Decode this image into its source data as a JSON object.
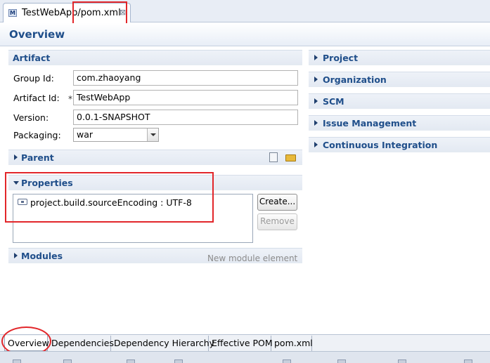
{
  "editor_tab": {
    "title": "TestWebApp/pom.xml",
    "icon_letter": "M",
    "close_glyph": "⊠"
  },
  "header": {
    "title": "Overview"
  },
  "artifact": {
    "title": "Artifact",
    "group_id_label": "Group Id:",
    "group_id_value": "com.zhaoyang",
    "artifact_id_label": "Artifact Id:",
    "artifact_id_required": "*",
    "artifact_id_value": "TestWebApp",
    "version_label": "Version:",
    "version_value": "0.0.1-SNAPSHOT",
    "packaging_label": "Packaging:",
    "packaging_value": "war"
  },
  "parent": {
    "title": "Parent"
  },
  "properties": {
    "title": "Properties",
    "items": [
      "project.build.sourceEncoding : UTF-8"
    ],
    "create_label": "Create...",
    "remove_label": "Remove"
  },
  "modules": {
    "title": "Modules",
    "new_hint": "New module element"
  },
  "right_sections": [
    "Project",
    "Organization",
    "SCM",
    "Issue Management",
    "Continuous Integration"
  ],
  "page_tabs": [
    "Overview",
    "Dependencies",
    "Dependency Hierarchy",
    "Effective POM",
    "pom.xml"
  ],
  "active_page_tab": "Overview",
  "colors": {
    "annotation_red": "#e2262a",
    "section_title": "#1f4e8a"
  }
}
